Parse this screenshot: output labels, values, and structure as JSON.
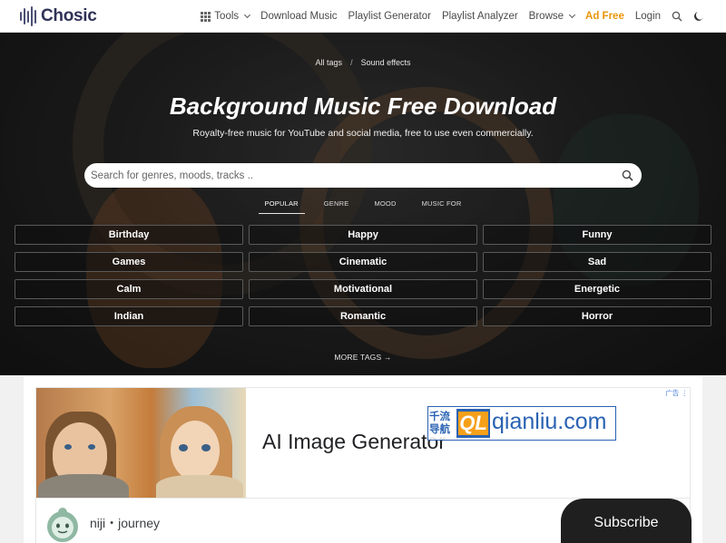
{
  "header": {
    "logo_text": "Chosic",
    "nav": {
      "tools": "Tools",
      "download_music": "Download Music",
      "playlist_generator": "Playlist Generator",
      "playlist_analyzer": "Playlist Analyzer",
      "browse": "Browse",
      "ad_free": "Ad Free",
      "login": "Login"
    },
    "icons": [
      "grid-icon",
      "chevron-down-icon",
      "search-icon",
      "moon-icon"
    ],
    "accent_color": "#e8960b"
  },
  "hero": {
    "breadcrumb": {
      "all_tags": "All tags",
      "separator": "/",
      "current": "Sound effects"
    },
    "title": "Background Music Free Download",
    "subtitle": "Royalty-free music for YouTube and social media, free to use even commercially.",
    "search": {
      "placeholder": "Search for genres, moods, tracks .."
    },
    "tabs": [
      {
        "label": "POPULAR",
        "active": true
      },
      {
        "label": "GENRE"
      },
      {
        "label": "MOOD"
      },
      {
        "label": "MUSIC FOR"
      }
    ],
    "tags": [
      "Birthday",
      "Happy",
      "Funny",
      "Games",
      "Cinematic",
      "Sad",
      "Calm",
      "Motivational",
      "Energetic",
      "Indian",
      "Romantic",
      "Horror"
    ],
    "more_tags": "MORE TAGS →"
  },
  "ad": {
    "choices_label": "广告 ⋮",
    "headline": "AI Image Generator",
    "brand": "niji・journey",
    "subscribe": "Subscribe",
    "watermark": {
      "cn": "千流导航",
      "ql": "QL",
      "url": "qianliu.com"
    }
  }
}
